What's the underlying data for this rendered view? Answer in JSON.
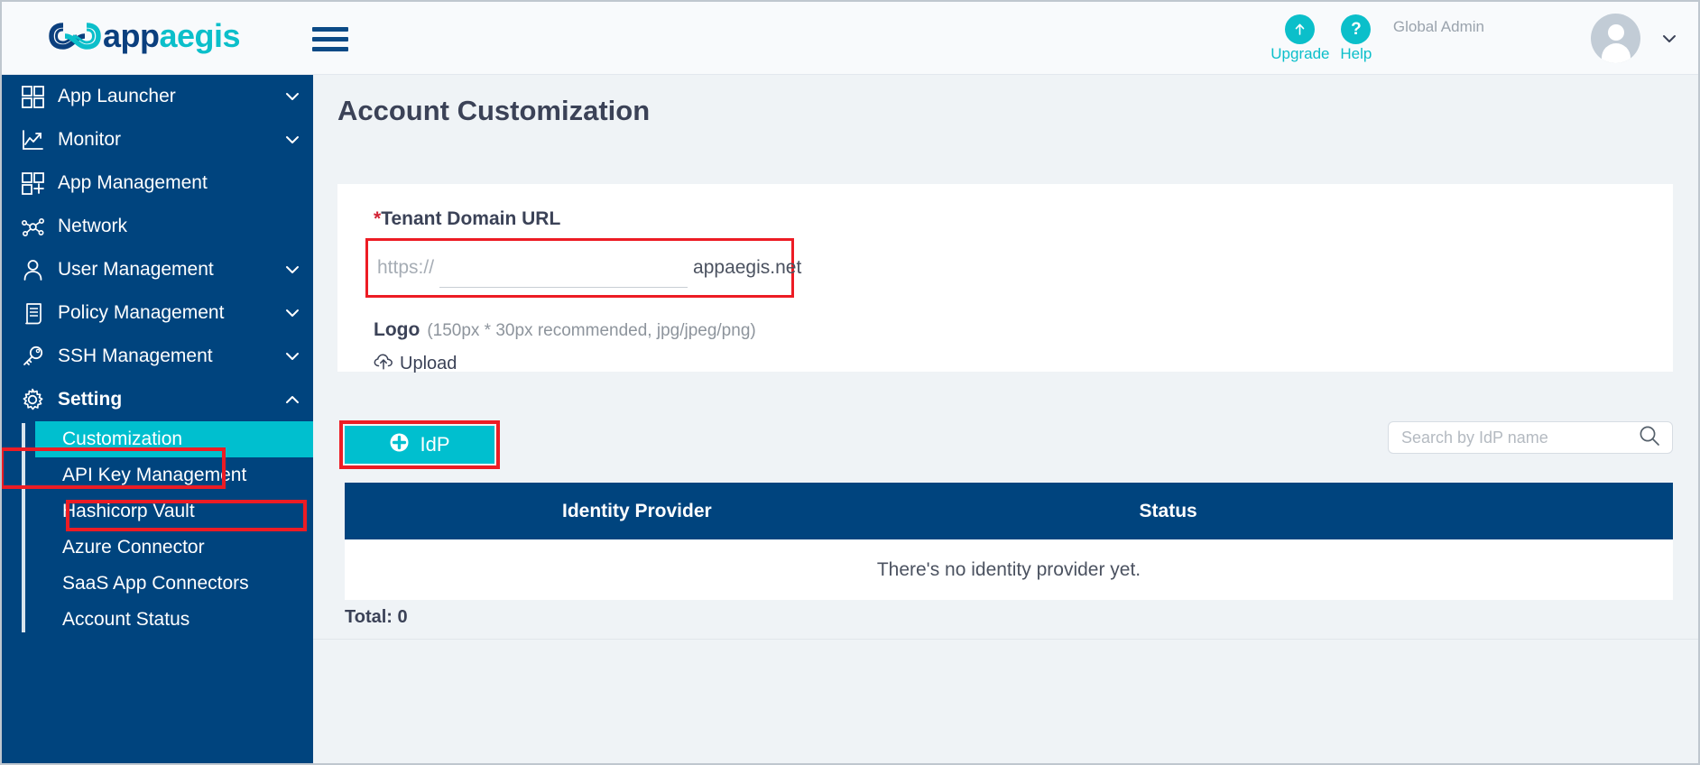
{
  "brand": {
    "name_part1": "app",
    "name_part2": "aegis",
    "primary_blue": "#00447e",
    "accent_teal": "#00bfcf",
    "annotation_red": "#ed1c24"
  },
  "header": {
    "upgrade_label": "Upgrade",
    "help_label": "Help",
    "help_glyph": "?",
    "role_label": "Global Admin",
    "menu_icon": "hamburger-icon",
    "avatar_icon": "user-avatar-icon",
    "caret_icon": "chevron-down-icon"
  },
  "sidebar": {
    "items": [
      {
        "label": "App Launcher",
        "icon": "grid-icon",
        "chevron": "chevron-down",
        "bold": false
      },
      {
        "label": "Monitor",
        "icon": "chart-line-icon",
        "chevron": "chevron-down",
        "bold": false
      },
      {
        "label": "App Management",
        "icon": "grid-plus-icon",
        "chevron": "",
        "bold": false
      },
      {
        "label": "Network",
        "icon": "network-icon",
        "chevron": "",
        "bold": false
      },
      {
        "label": "User Management",
        "icon": "user-icon",
        "chevron": "chevron-down",
        "bold": false
      },
      {
        "label": "Policy Management",
        "icon": "document-icon",
        "chevron": "chevron-down",
        "bold": false
      },
      {
        "label": "SSH Management",
        "icon": "key-icon",
        "chevron": "chevron-down",
        "bold": false
      },
      {
        "label": "Setting",
        "icon": "gear-icon",
        "chevron": "chevron-up",
        "bold": true
      }
    ],
    "sub_items": [
      {
        "label": "Customization",
        "active": true
      },
      {
        "label": "API Key Management",
        "active": false
      },
      {
        "label": "Hashicorp Vault",
        "active": false
      },
      {
        "label": "Azure Connector",
        "active": false
      },
      {
        "label": "SaaS App Connectors",
        "active": false
      },
      {
        "label": "Account Status",
        "active": false
      }
    ]
  },
  "main": {
    "page_title": "Account Customization",
    "tenant": {
      "required_mark": "*",
      "label": "Tenant Domain URL",
      "prefix": "https://",
      "value": "",
      "placeholder": "",
      "suffix": "appaegis.net"
    },
    "logo": {
      "label": "Logo",
      "hint": "(150px * 30px recommended, jpg/jpeg/png)",
      "upload_label": "Upload",
      "upload_icon": "cloud-upload-icon"
    },
    "idp_button": {
      "label": "IdP",
      "icon": "plus-circle-icon"
    },
    "search": {
      "placeholder": "Search by IdP name",
      "value": "",
      "icon": "search-icon"
    },
    "table": {
      "columns": [
        "Identity Provider",
        "Status"
      ],
      "rows": [],
      "empty_message": "There's no identity provider yet.",
      "total_label": "Total: 0"
    }
  }
}
